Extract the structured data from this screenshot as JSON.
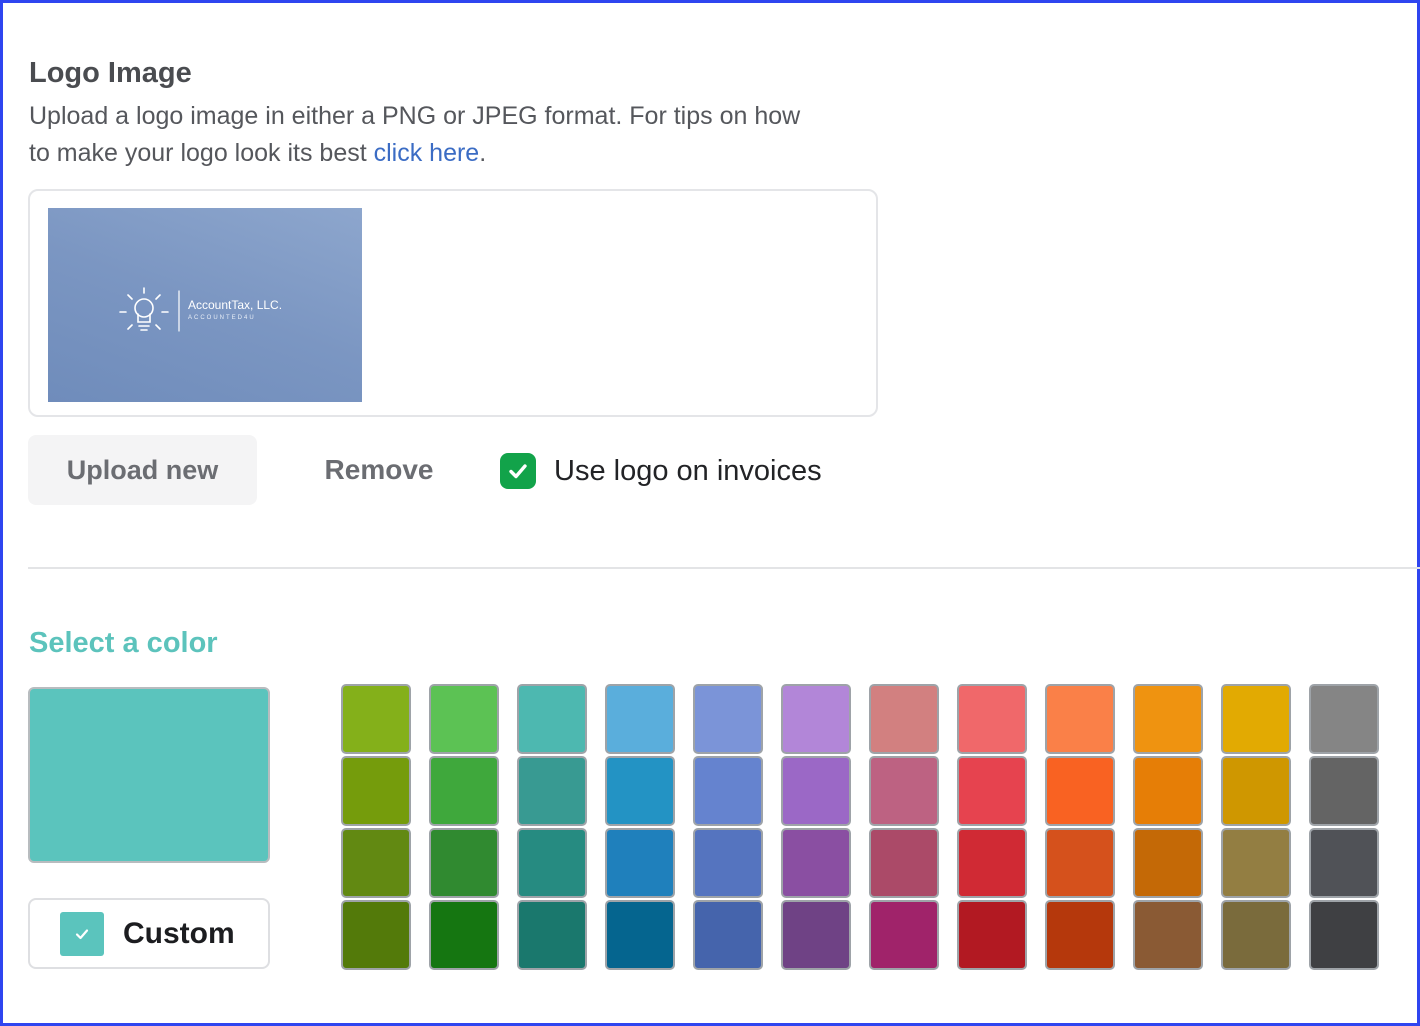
{
  "logo_section": {
    "title": "Logo Image",
    "description_text": "Upload a logo image in either a PNG or JPEG format. For tips on how to make your logo look its best ",
    "description_link": "click here",
    "description_end": ".",
    "logo": {
      "company_name": "AccountTax, LLC.",
      "tagline": "ACCOUNTED4U"
    },
    "upload_label": "Upload new",
    "remove_label": "Remove",
    "use_logo_label": "Use logo on invoices",
    "use_logo_checked": true
  },
  "color_section": {
    "title": "Select a color",
    "selected_color": "#5bc4bd",
    "custom_label": "Custom",
    "custom_checked": true,
    "palette": [
      [
        "#84b01a",
        "#5cc254",
        "#4db8b0",
        "#5aaedc",
        "#7b94d8",
        "#b286d8",
        "#d28080",
        "#f0686a",
        "#fa8048",
        "#ef9310",
        "#e2aa02",
        "#858585"
      ],
      [
        "#759c0c",
        "#3fa83c",
        "#389a92",
        "#2393c4",
        "#6583cf",
        "#9b68c6",
        "#bd6282",
        "#e6434f",
        "#f96222",
        "#e67e06",
        "#cf9700",
        "#646464"
      ],
      [
        "#628912",
        "#308a30",
        "#268b81",
        "#1f80bc",
        "#5574bf",
        "#8a4fa2",
        "#ab4a68",
        "#d02a34",
        "#d5511c",
        "#c46906",
        "#937e42",
        "#505257"
      ],
      [
        "#537a0a",
        "#157611",
        "#1a786d",
        "#05658f",
        "#4564ac",
        "#6f4285",
        "#a0236a",
        "#b21922",
        "#b5380c",
        "#8a5a34",
        "#7a6b3c",
        "#3f4043"
      ]
    ]
  }
}
